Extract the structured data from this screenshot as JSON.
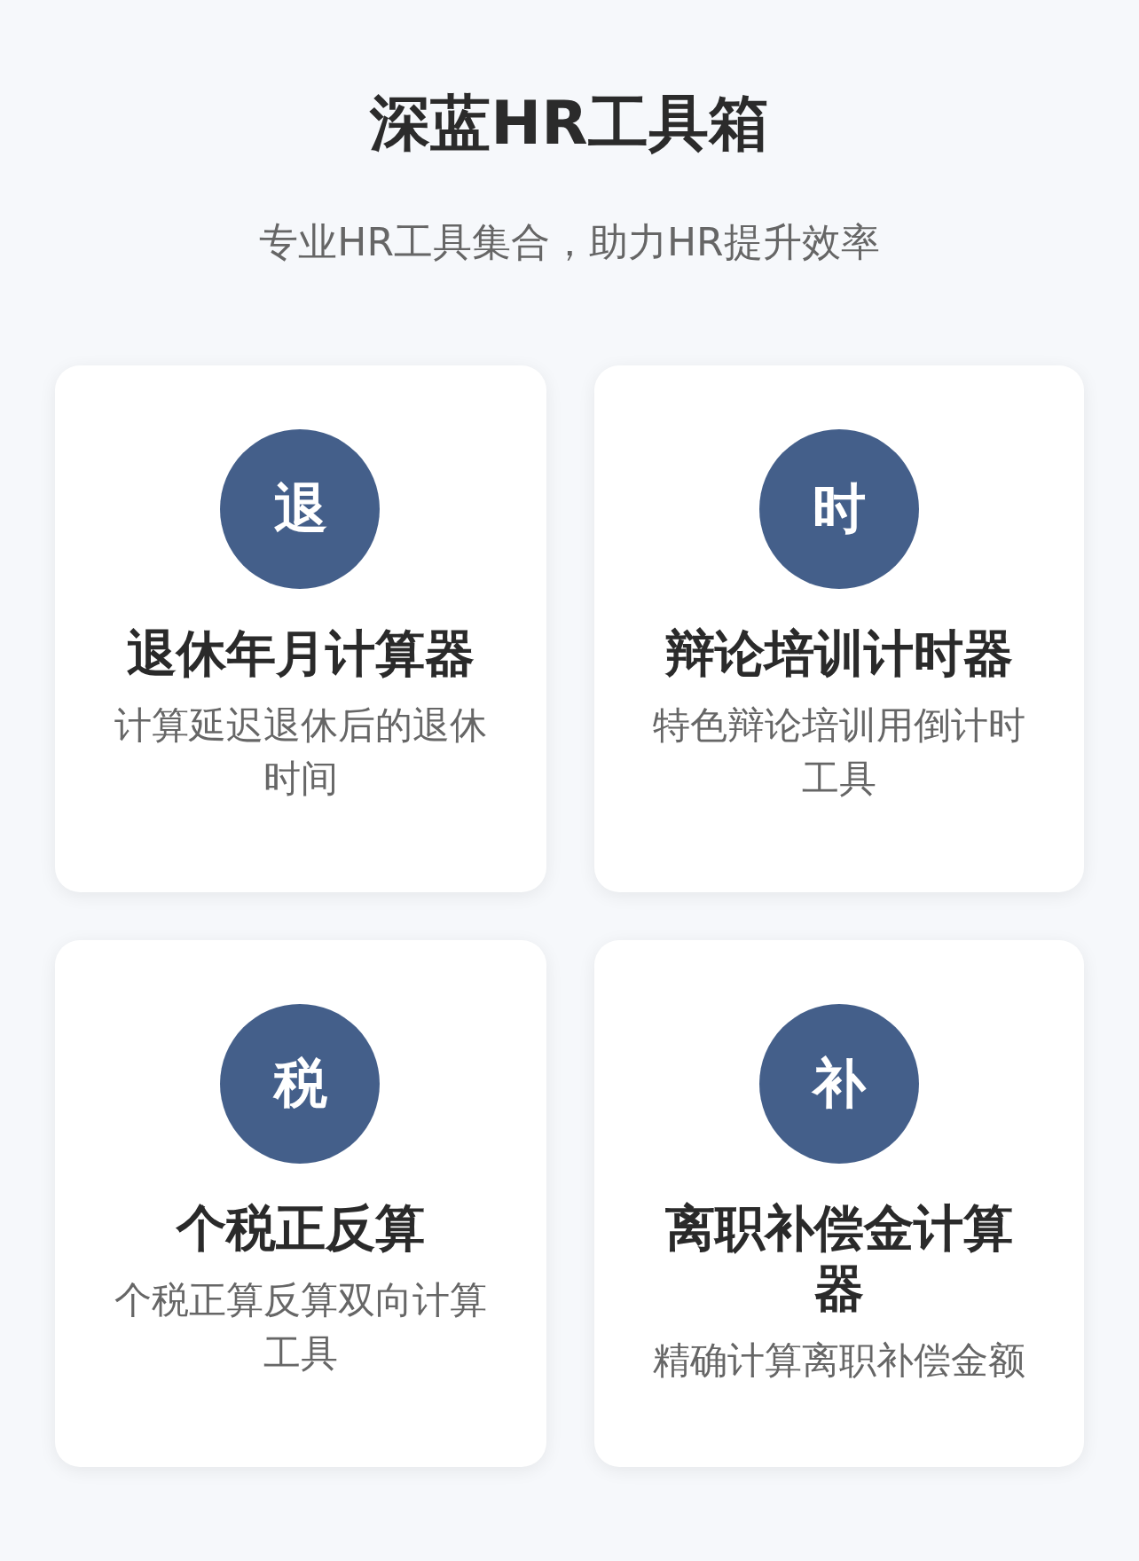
{
  "header": {
    "title": "深蓝HR工具箱",
    "subtitle": "专业HR工具集合，助力HR提升效率"
  },
  "tools": [
    {
      "icon_char": "退",
      "title": "退休年月计算器",
      "description": "计算延迟退休后的退休时间"
    },
    {
      "icon_char": "时",
      "title": "辩论培训计时器",
      "description": "特色辩论培训用倒计时工具"
    },
    {
      "icon_char": "税",
      "title": "个税正反算",
      "description": "个税正算反算双向计算工具"
    },
    {
      "icon_char": "补",
      "title": "离职补偿金计算器",
      "description": "精确计算离职补偿金额"
    }
  ]
}
